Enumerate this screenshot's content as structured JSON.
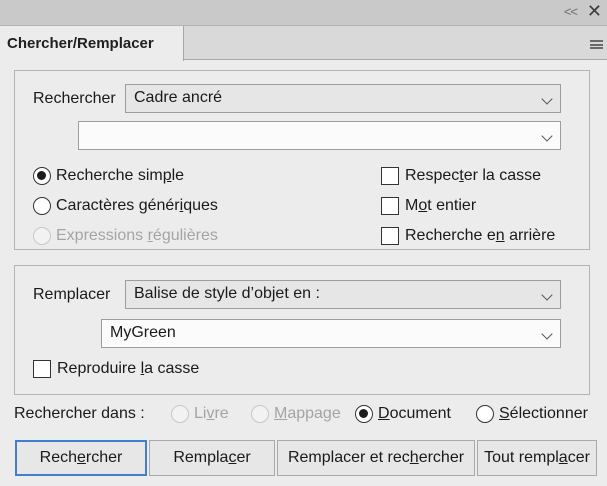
{
  "panel": {
    "tab_title": "Chercher/Remplacer",
    "collapse_glyph": "<<",
    "close_glyph": "✕"
  },
  "find": {
    "label": "Rechercher",
    "type_select": "Cadre ancré",
    "value_select": ""
  },
  "options_left": [
    {
      "pre": "Recherche sim",
      "u": "p",
      "post": "le",
      "checked": true,
      "enabled": true
    },
    {
      "pre": "Caractères génér",
      "u": "i",
      "post": "ques",
      "checked": false,
      "enabled": true
    },
    {
      "pre": "Expressions ",
      "u": "r",
      "post": "égulières",
      "checked": false,
      "enabled": false
    }
  ],
  "options_right": [
    {
      "pre": "Respec",
      "u": "t",
      "post": "er la casse",
      "checked": false
    },
    {
      "pre": "M",
      "u": "o",
      "post": "t entier",
      "checked": false
    },
    {
      "pre": "Recherche e",
      "u": "n",
      "post": " arrière",
      "checked": false
    }
  ],
  "replace": {
    "label": "Remplacer",
    "type_select": "Balise de style d’objet en :",
    "value_select": "MyGreen",
    "match_case": {
      "pre": "Reproduire ",
      "u": "l",
      "post": "a casse",
      "checked": false
    }
  },
  "scope": {
    "label": "Rechercher dans :",
    "options": [
      {
        "pre": "Li",
        "u": "v",
        "post": "re",
        "checked": false,
        "enabled": false
      },
      {
        "pre": "",
        "u": "M",
        "post": "appage",
        "checked": false,
        "enabled": false
      },
      {
        "pre": "",
        "u": "D",
        "post": "ocument",
        "checked": true,
        "enabled": true
      },
      {
        "pre": "",
        "u": "S",
        "post": "électionner",
        "checked": false,
        "enabled": true
      }
    ]
  },
  "buttons": [
    {
      "pre": "Rech",
      "u": "e",
      "post": "rcher"
    },
    {
      "pre": "Rempla",
      "u": "c",
      "post": "er"
    },
    {
      "pre": "Remplacer et rec",
      "u": "h",
      "post": "ercher"
    },
    {
      "pre": "Tout rempl",
      "u": "a",
      "post": "cer"
    }
  ]
}
